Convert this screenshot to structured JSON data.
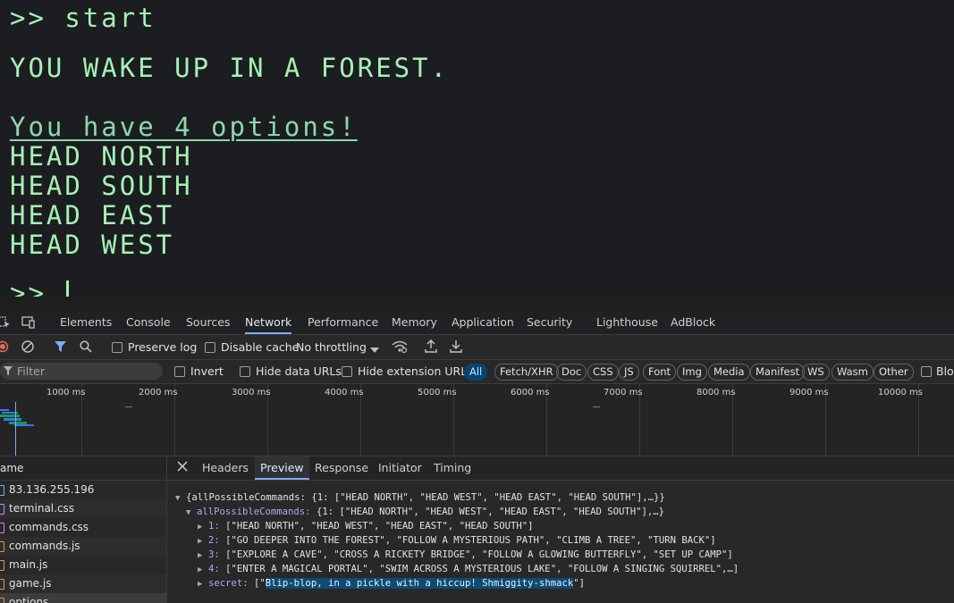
{
  "terminal": {
    "lines": [
      ">> start",
      "YOU WAKE UP IN A FOREST.",
      "You have 4 options!",
      "HEAD NORTH",
      "HEAD SOUTH",
      "HEAD EAST",
      "HEAD WEST",
      ">> "
    ]
  },
  "devtools": {
    "panel_tabs": [
      "Elements",
      "Console",
      "Sources",
      "Network",
      "Performance",
      "Memory",
      "Application",
      "Security",
      "Lighthouse",
      "AdBlock"
    ],
    "active_panel": "Network",
    "toolbar": {
      "preserve_log": "Preserve log",
      "disable_cache": "Disable cache",
      "throttling": "No throttling"
    },
    "filter": {
      "placeholder": "Filter",
      "invert": "Invert",
      "hide_data_urls": "Hide data URLs",
      "hide_extension_urls": "Hide extension URLs",
      "types": [
        "All",
        "Fetch/XHR",
        "Doc",
        "CSS",
        "JS",
        "Font",
        "Img",
        "Media",
        "Manifest",
        "WS",
        "Wasm",
        "Other"
      ],
      "blocked_partial": "Bloc"
    },
    "timeline_ticks": [
      "1000 ms",
      "2000 ms",
      "3000 ms",
      "4000 ms",
      "5000 ms",
      "6000 ms",
      "7000 ms",
      "8000 ms",
      "9000 ms",
      "10000 ms"
    ],
    "names_header": "ame",
    "requests": [
      "83.136.255.196",
      "terminal.css",
      "commands.css",
      "commands.js",
      "main.js",
      "game.js",
      "options"
    ],
    "detail_tabs": [
      "Headers",
      "Preview",
      "Response",
      "Initiator",
      "Timing"
    ],
    "active_detail": "Preview",
    "preview": {
      "root_key": "{allPossibleCommands:",
      "root_val": " {1: [\"HEAD NORTH\", \"HEAD WEST\", \"HEAD EAST\", \"HEAD SOUTH\"],…}}",
      "apc_key": "allPossibleCommands:",
      "apc_val": " {1: [\"HEAD NORTH\", \"HEAD WEST\", \"HEAD EAST\", \"HEAD SOUTH\"],…}",
      "items": [
        {
          "key": "1:",
          "val": " [\"HEAD NORTH\", \"HEAD WEST\", \"HEAD EAST\", \"HEAD SOUTH\"]"
        },
        {
          "key": "2:",
          "val": " [\"GO DEEPER INTO THE FOREST\", \"FOLLOW A MYSTERIOUS PATH\", \"CLIMB A TREE\", \"TURN BACK\"]"
        },
        {
          "key": "3:",
          "val": " [\"EXPLORE A CAVE\", \"CROSS A RICKETY BRIDGE\", \"FOLLOW A GLOWING BUTTERFLY\", \"SET UP CAMP\"]"
        },
        {
          "key": "4:",
          "val": " [\"ENTER A MAGICAL PORTAL\", \"SWIM ACROSS A MYSTERIOUS LAKE\", \"FOLLOW A SINGING SQUIRREL\",…]"
        }
      ],
      "secret_key": "secret:",
      "secret_open": " [\"",
      "secret_val": "Blip-blop, in a pickle with a hiccup! Shmiggity-shmack",
      "secret_close": "\"]"
    }
  }
}
